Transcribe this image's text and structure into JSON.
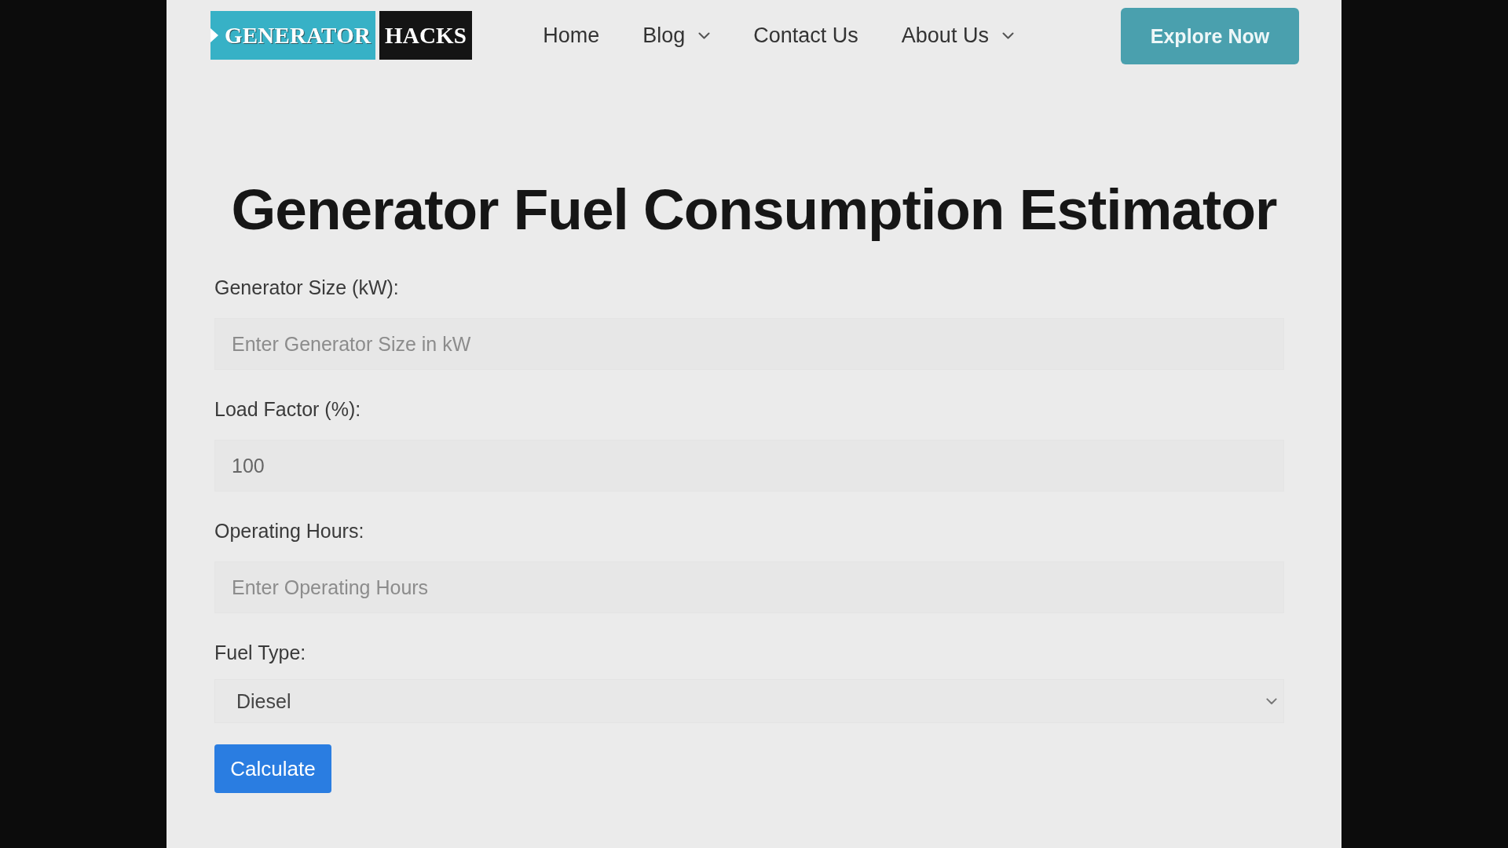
{
  "header": {
    "logo": {
      "left": "GENERATOR",
      "right": "HACKS"
    },
    "nav": [
      {
        "label": "Home",
        "has_menu": false
      },
      {
        "label": "Blog",
        "has_menu": true
      },
      {
        "label": "Contact Us",
        "has_menu": false
      },
      {
        "label": "About Us",
        "has_menu": true
      }
    ],
    "cta": "Explore Now"
  },
  "title": "Generator Fuel Consumption Estimator",
  "form": {
    "fields": [
      {
        "kind": "input",
        "label": "Generator Size (kW):",
        "placeholder": "Enter Generator Size in kW"
      },
      {
        "kind": "input",
        "label": "Load Factor (%):",
        "value": "100"
      },
      {
        "kind": "input",
        "label": "Operating Hours:",
        "placeholder": "Enter Operating Hours"
      },
      {
        "kind": "select",
        "label": "Fuel Type:",
        "value": "Diesel"
      }
    ],
    "submit": "Calculate"
  }
}
